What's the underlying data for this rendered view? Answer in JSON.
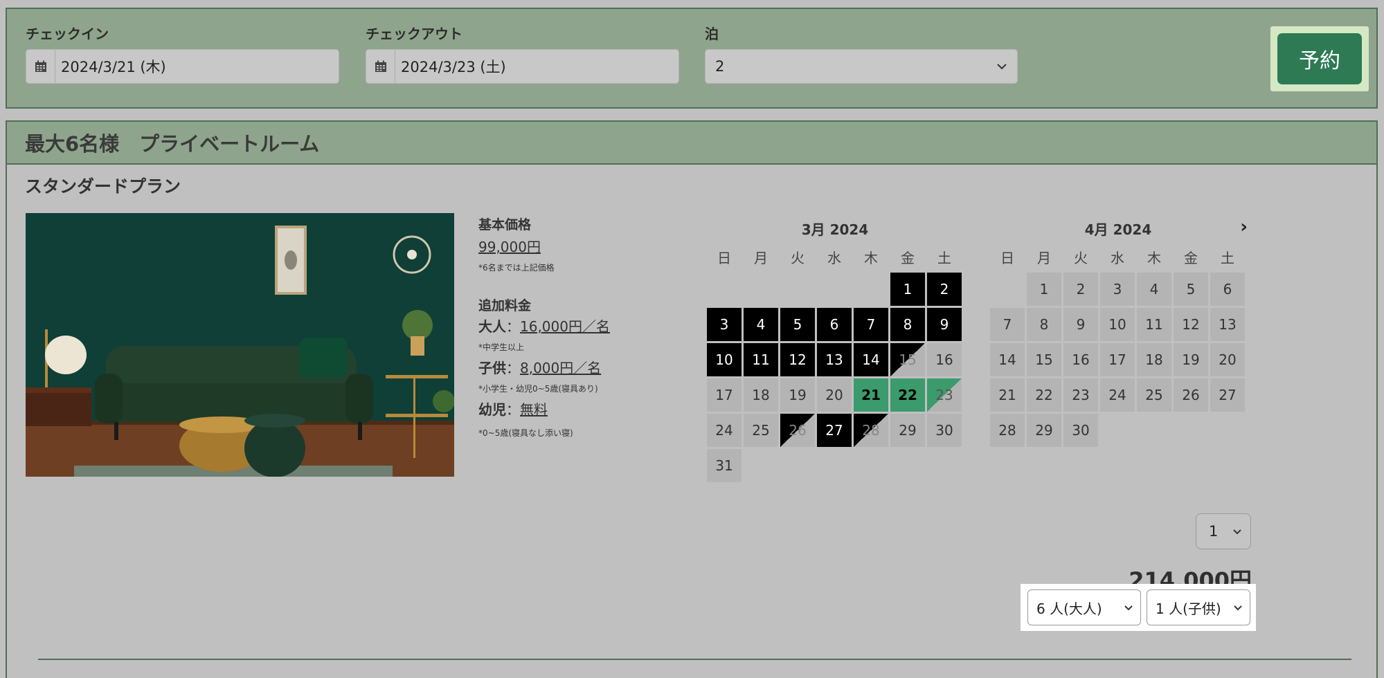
{
  "search": {
    "checkin_label": "チェックイン",
    "checkin_value": "2024/3/21 (木)",
    "checkout_label": "チェックアウト",
    "checkout_value": "2024/3/23 (土)",
    "nights_label": "泊",
    "nights_value": "2",
    "reserve_label": "予約",
    "icon": "calendar-icon"
  },
  "room": {
    "title": "最大6名様　プライベートルーム",
    "plan": "スタンダードプラン",
    "photo": "living-room-photo"
  },
  "pricing": {
    "base_heading": "基本価格",
    "base_price": "99,000円",
    "base_note": "*6名までは上記価格",
    "extra_heading": "追加料金",
    "adult_label": "大人",
    "adult_price": "16,000円／名",
    "adult_note": "*中学生以上",
    "child_label": "子供",
    "child_price": "8,000円／名",
    "child_note": "*小学生・幼児0~5歳(寝具あり)",
    "infant_label": "幼児",
    "infant_price": "無料",
    "infant_note": "*0~5歳(寝具なし添い寝)",
    "separator": "："
  },
  "calendars": [
    {
      "title": "3月 2024",
      "weekdays": [
        "日",
        "月",
        "火",
        "水",
        "木",
        "金",
        "土"
      ],
      "offset": 5,
      "days": 31,
      "blocked": [
        1,
        2,
        3,
        4,
        5,
        6,
        7,
        8,
        9,
        10,
        11,
        12,
        13,
        14,
        27
      ],
      "checkout_diag": [
        15,
        26,
        28
      ],
      "selected": [
        21,
        22
      ],
      "selected_diag": [
        23
      ],
      "has_next": false
    },
    {
      "title": "4月 2024",
      "weekdays": [
        "日",
        "月",
        "火",
        "水",
        "木",
        "金",
        "土"
      ],
      "offset": 1,
      "days": 30,
      "blocked": [],
      "checkout_diag": [],
      "selected": [],
      "selected_diag": [],
      "has_next": true,
      "next_label": "›"
    }
  ],
  "booking": {
    "quantity": "1",
    "total": "214,000円",
    "adults": "6 人(大人)",
    "children": "1 人(子供)"
  },
  "colors": {
    "header_green": "#8fa48c",
    "border_green": "#4f6e55",
    "button_green": "#2e7a55",
    "selected_green": "#3b9b6c",
    "blocked": "#000000"
  }
}
